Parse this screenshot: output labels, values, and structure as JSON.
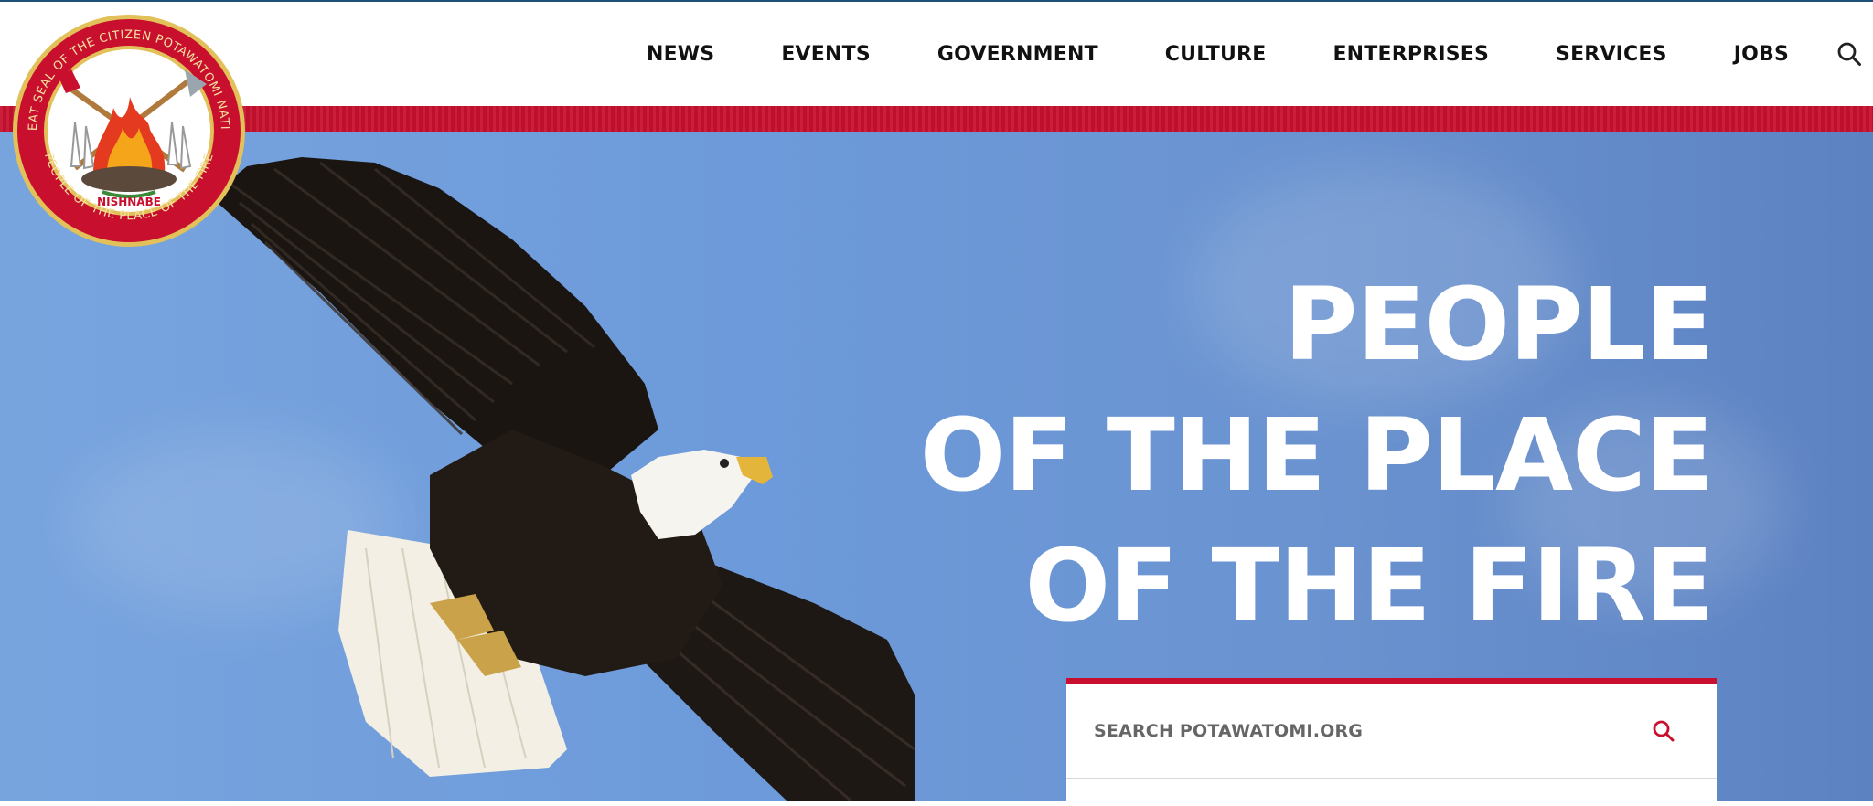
{
  "nav": {
    "items": [
      {
        "label": "NEWS"
      },
      {
        "label": "EVENTS"
      },
      {
        "label": "GOVERNMENT"
      },
      {
        "label": "CULTURE"
      },
      {
        "label": "ENTERPRISES"
      },
      {
        "label": "SERVICES"
      },
      {
        "label": "JOBS"
      }
    ],
    "search_icon": "search-icon"
  },
  "seal": {
    "outer_text": "GREAT SEAL OF THE CITIZEN POTAWATOMI NATION",
    "bottom_text": "PEOPLE OF THE PLACE OF THE FIRE",
    "center_text": "NISHNABE"
  },
  "hero": {
    "headline": [
      "PEOPLE",
      "OF THE PLACE",
      "OF THE FIRE"
    ]
  },
  "search": {
    "placeholder": "SEARCH POTAWATOMI.ORG",
    "icon": "search-icon"
  },
  "colors": {
    "brand_red": "#c8102e",
    "sky_blue": "#6d9ada",
    "nav_text": "#111111",
    "top_rule": "#1f4e79"
  }
}
